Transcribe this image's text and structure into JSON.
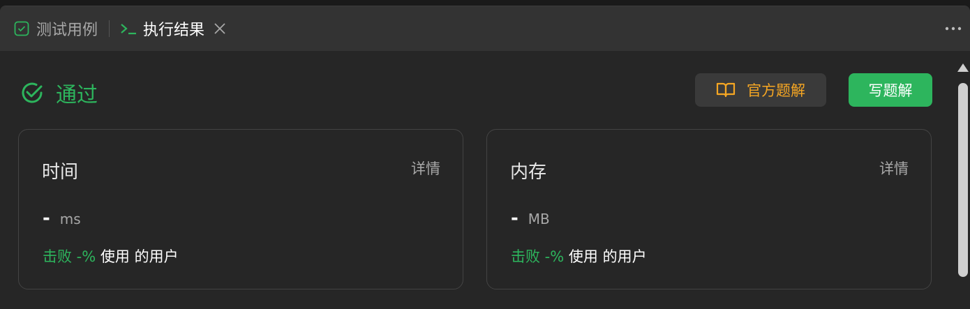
{
  "tabs": [
    {
      "label": "测试用例",
      "icon": "checkbox-icon"
    },
    {
      "label": "执行结果",
      "icon": "terminal-icon",
      "active": true
    }
  ],
  "status": {
    "label": "通过",
    "color": "#2db55d"
  },
  "buttons": {
    "official_solution": "官方题解",
    "write_solution": "写题解"
  },
  "cards": {
    "time": {
      "title": "时间",
      "detail": "详情",
      "value": "-",
      "unit": "ms",
      "beat_prefix": "击败 -%",
      "beat_suffix": "使用 的用户"
    },
    "memory": {
      "title": "内存",
      "detail": "详情",
      "value": "-",
      "unit": "MB",
      "beat_prefix": "击败 -%",
      "beat_suffix": "使用 的用户"
    }
  },
  "colors": {
    "accent_green": "#2db55d",
    "accent_orange": "#f5a623",
    "background": "#262626"
  }
}
